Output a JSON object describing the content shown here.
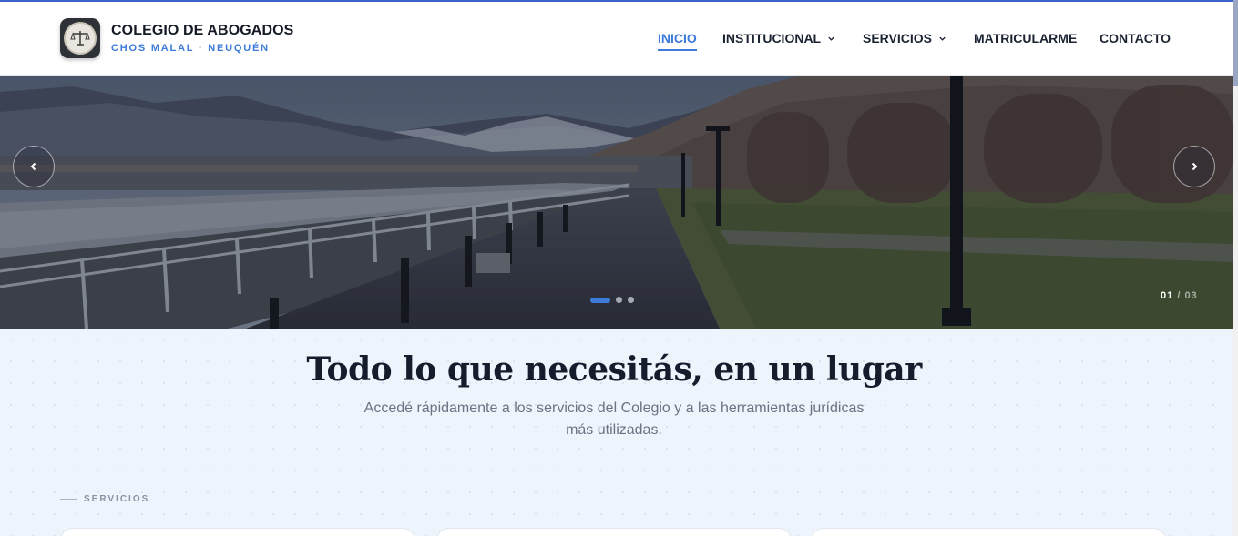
{
  "header": {
    "brand_title": "COLEGIO DE ABOGADOS",
    "brand_subtitle": "CHOS MALAL · NEUQUÉN",
    "logo_icon": "scales-of-justice-icon",
    "nav": [
      {
        "label": "INICIO",
        "active": true,
        "has_dropdown": false
      },
      {
        "label": "INSTITUCIONAL",
        "active": false,
        "has_dropdown": true
      },
      {
        "label": "SERVICIOS",
        "active": false,
        "has_dropdown": true
      },
      {
        "label": "MATRICULARME",
        "active": false,
        "has_dropdown": false
      },
      {
        "label": "CONTACTO",
        "active": false,
        "has_dropdown": false
      }
    ]
  },
  "hero": {
    "slide_current": "01",
    "slide_separator": "/",
    "slide_total": "03",
    "active_dot": 0,
    "dot_count": 3,
    "prev_icon": "chevron-left-icon",
    "next_icon": "chevron-right-icon"
  },
  "intro": {
    "headline": "Todo lo que necesitás, en un lugar",
    "subtitle": "Accedé rápidamente a los servicios del Colegio y a las herramientas jurídicas más utilizadas."
  },
  "services": {
    "eyebrow": "SERVICIOS"
  },
  "colors": {
    "accent": "#3c7bd9",
    "top_bar": "#3a63c9",
    "page_bg": "#eef4fc",
    "heading": "#151c2c"
  }
}
